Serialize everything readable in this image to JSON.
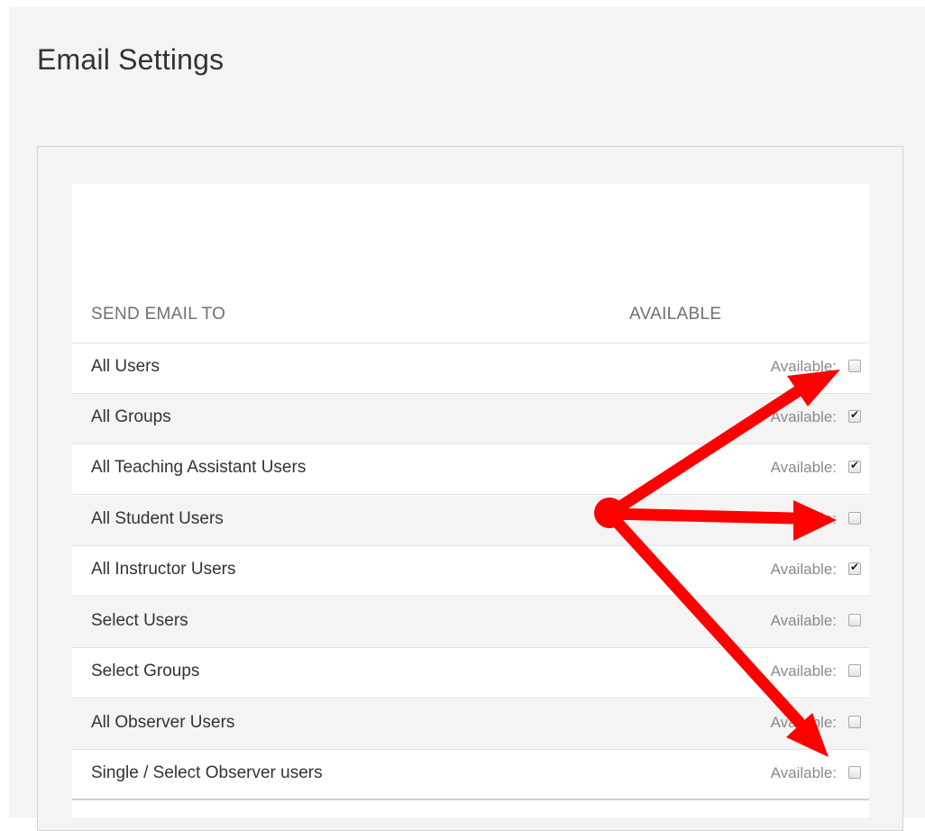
{
  "page": {
    "title": "Email Settings"
  },
  "table": {
    "headers": {
      "send_email_to": "SEND EMAIL TO",
      "available": "AVAILABLE"
    },
    "available_label": "Available:",
    "rows": [
      {
        "label": "All Users",
        "available": false
      },
      {
        "label": "All Groups",
        "available": true
      },
      {
        "label": "All Teaching Assistant Users",
        "available": true
      },
      {
        "label": "All Student Users",
        "available": false
      },
      {
        "label": "All Instructor Users",
        "available": true
      },
      {
        "label": "Select Users",
        "available": false
      },
      {
        "label": "Select Groups",
        "available": false
      },
      {
        "label": "All Observer Users",
        "available": false
      },
      {
        "label": "Single / Select Observer users",
        "available": false
      }
    ]
  },
  "colors": {
    "annotation_arrows": "#ff0000",
    "text": "#333333",
    "muted": "#8a8a8a"
  }
}
